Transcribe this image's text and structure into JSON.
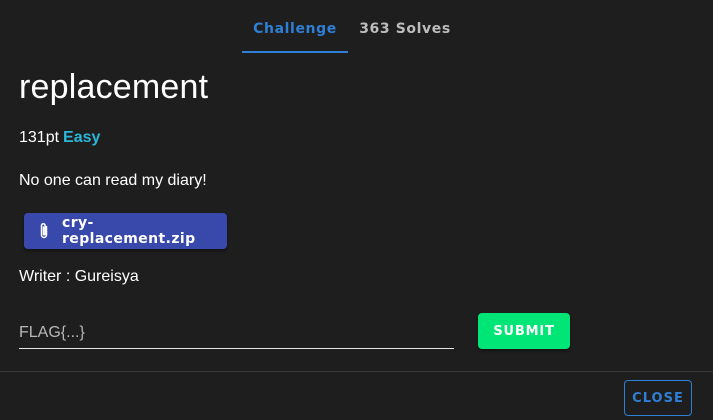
{
  "tabs": {
    "challenge_label": "Challenge",
    "solves_label": "363 Solves"
  },
  "challenge": {
    "title": "replacement",
    "points": "131pt",
    "difficulty": "Easy",
    "description": "No one can read my diary!",
    "file_name": "cry-replacement.zip",
    "writer": "Writer : Gureisya"
  },
  "flag_input": {
    "placeholder": "FLAG{...}",
    "value": ""
  },
  "buttons": {
    "submit_label": "SUBMIT",
    "close_label": "CLOSE"
  },
  "icons": {
    "file": "paperclip-icon"
  },
  "colors": {
    "accent": "#2f7fd6",
    "difficulty": "#29b6d8",
    "file_button": "#3949ab",
    "submit_button": "#00e676",
    "background": "#1e1e1e"
  }
}
